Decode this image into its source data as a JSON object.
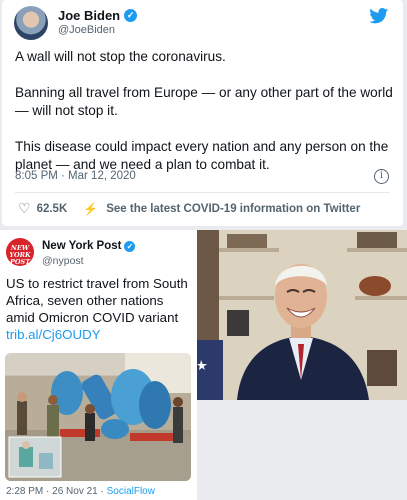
{
  "top_tweet": {
    "name": "Joe Biden",
    "handle": "@JoeBiden",
    "paragraphs": [
      "A wall will not stop the coronavirus.",
      "Banning all travel from Europe — or any other part of the world — will not stop it.",
      "This disease could impact every nation and any person on the planet — and we need a plan to combat it."
    ],
    "timestamp": "8:05 PM · Mar 12, 2020",
    "likes": "62.5K",
    "covid_info": "See the latest COVID-19 information on Twitter",
    "accent": "#1d9bf0"
  },
  "nyp_tweet": {
    "logo_text": "NEW YORK POST",
    "name": "New York Post",
    "handle": "@nypost",
    "text": "US to restrict travel from South Africa, seven other nations amid Omicron COVID variant ",
    "link": "trib.al/Cj6OUDY",
    "timestamp": "2:28 PM · 26 Nov 21 · ",
    "source": "SocialFlow",
    "logo_color": "#d8232a"
  },
  "icons": [
    "twitter-bird-icon",
    "verified-icon",
    "info-icon",
    "heart-icon",
    "bolt-icon"
  ]
}
